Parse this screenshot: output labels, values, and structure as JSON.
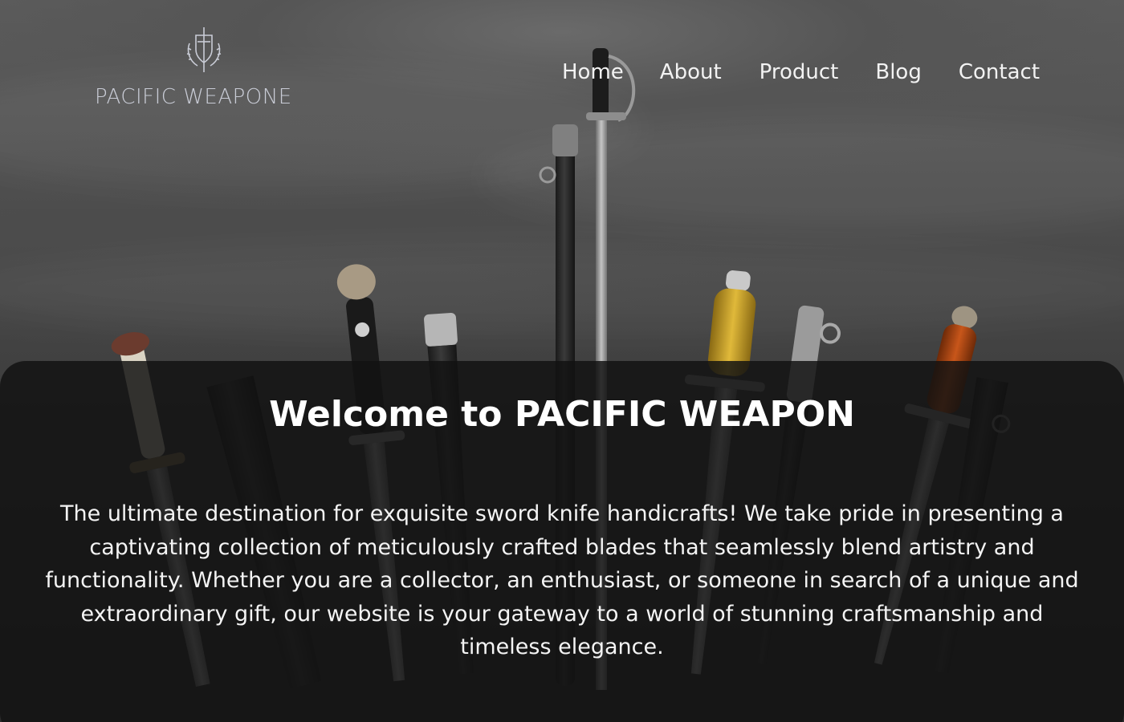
{
  "brand": {
    "name": "PACIFIC WEAPONE",
    "emblem_icon": "sword-shield-laurel-icon",
    "text_color": "#c9ccd6"
  },
  "nav": {
    "items": [
      {
        "label": "Home"
      },
      {
        "label": "About"
      },
      {
        "label": "Product"
      },
      {
        "label": "Blog"
      },
      {
        "label": "Contact"
      }
    ]
  },
  "hero": {
    "title": "Welcome to PACIFIC WEAPON",
    "description": "The ultimate destination for exquisite sword knife handicrafts! We take pride in presenting a captivating collection of meticulously crafted blades that seamlessly blend artistry and functionality. Whether you are a collector, an enthusiast, or someone in search of a unique and extraordinary gift, our website is your gateway to a world of stunning craftsmanship and timeless elegance."
  },
  "colors": {
    "background": "#4a4a4a",
    "panel": "#121212",
    "text": "#ffffff"
  }
}
